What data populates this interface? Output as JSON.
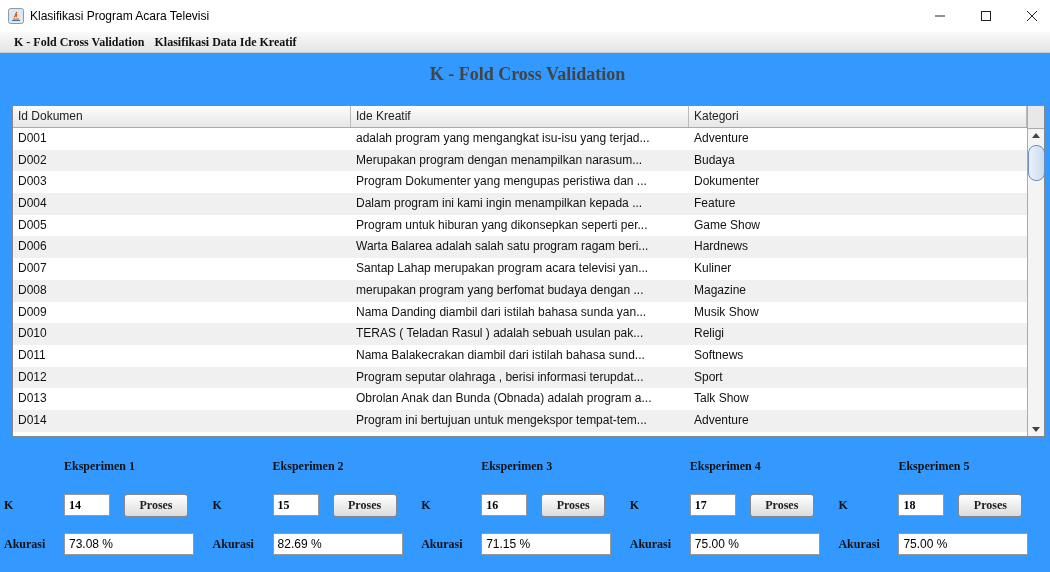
{
  "window": {
    "title": "Klasifikasi Program Acara Televisi"
  },
  "menu": [
    {
      "label": "K - Fold Cross Validation"
    },
    {
      "label": "Klasifikasi Data Ide Kreatif"
    }
  ],
  "heading": "K - Fold Cross Validation",
  "table": {
    "columns": [
      "Id Dokumen",
      "Ide Kreatif",
      "Kategori"
    ],
    "rows": [
      [
        "D001",
        "adalah program yang mengangkat isu-isu yang terjad...",
        "Adventure"
      ],
      [
        "D002",
        "Merupakan program dengan menampilkan narasum...",
        "Budaya"
      ],
      [
        "D003",
        "Program Dokumenter yang mengupas peristiwa dan ...",
        "Dokumenter"
      ],
      [
        "D004",
        "Dalam program ini kami ingin menampilkan kepada ...",
        "Feature"
      ],
      [
        "D005",
        "Program untuk hiburan yang dikonsepkan seperti per...",
        "Game Show"
      ],
      [
        "D006",
        "Warta Balarea adalah salah satu program ragam beri...",
        "Hardnews"
      ],
      [
        "D007",
        "Santap Lahap merupakan program acara televisi yan...",
        "Kuliner"
      ],
      [
        "D008",
        "merupakan program yang berfomat budaya dengan ...",
        "Magazine"
      ],
      [
        "D009",
        "Nama Danding diambil dari istilah bahasa sunda yan...",
        "Musik Show"
      ],
      [
        "D010",
        "TERAS ( Teladan Rasul ) adalah sebuah usulan pak...",
        "Religi"
      ],
      [
        "D011",
        "Nama Balakecrakan diambil dari istilah bahasa sund...",
        "Softnews"
      ],
      [
        "D012",
        "Program seputar olahraga , berisi informasi terupdat...",
        "Sport"
      ],
      [
        "D013",
        "Obrolan Anak dan Bunda (Obnada) adalah program a...",
        "Talk Show"
      ],
      [
        "D014",
        "Program ini bertujuan untuk mengekspor tempat-tem...",
        "Adventure"
      ]
    ]
  },
  "experiments": [
    {
      "title": "Eksperimen 1",
      "k_label": "K",
      "k": "14",
      "button": "Proses",
      "accuracy_label": "Akurasi",
      "accuracy": "73.08 %"
    },
    {
      "title": "Eksperimen 2",
      "k_label": "K",
      "k": "15",
      "button": "Proses",
      "accuracy_label": "Akurasi",
      "accuracy": "82.69 %"
    },
    {
      "title": "Eksperimen 3",
      "k_label": "K",
      "k": "16",
      "button": "Proses",
      "accuracy_label": "Akurasi",
      "accuracy": "71.15 %"
    },
    {
      "title": "Eksperimen 4",
      "k_label": "K",
      "k": "17",
      "button": "Proses",
      "accuracy_label": "Akurasi",
      "accuracy": "75.00 %"
    },
    {
      "title": "Eksperimen 5",
      "k_label": "K",
      "k": "18",
      "button": "Proses",
      "accuracy_label": "Akurasi",
      "accuracy": "75.00 %"
    }
  ]
}
